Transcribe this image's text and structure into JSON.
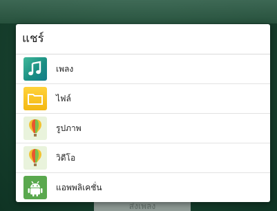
{
  "dialog": {
    "title": "แชร์",
    "items": [
      {
        "label": "เพลง",
        "icon": "music-icon"
      },
      {
        "label": "ไฟล์",
        "icon": "folder-icon"
      },
      {
        "label": "รูปภาพ",
        "icon": "balloon-icon"
      },
      {
        "label": "วิดีโอ",
        "icon": "balloon-icon"
      },
      {
        "label": "แอพพลิเคชั่น",
        "icon": "android-icon"
      }
    ]
  },
  "background": {
    "bottom_button_label": "ส่งเพลง"
  },
  "colors": {
    "backdrop": "#173f2d",
    "dialog_bg": "#ffffff",
    "divider": "#e2e2e2",
    "android_green": "#5aa84e",
    "folder_yellow": "#f3b813",
    "music_teal": "#1b8f83"
  }
}
